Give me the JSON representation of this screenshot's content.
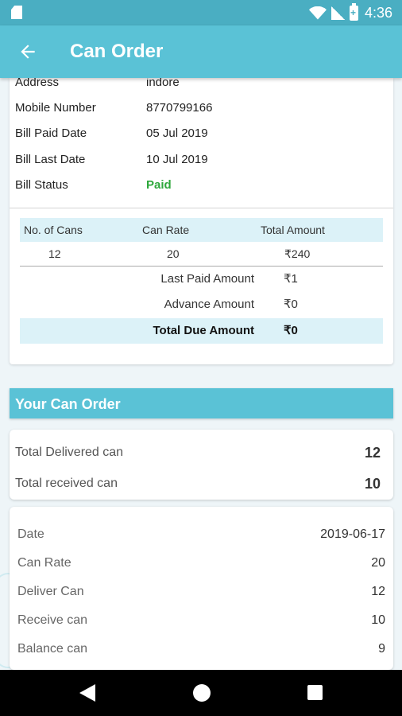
{
  "status_bar": {
    "time": "4:36",
    "battery_glyph": "+",
    "icons": [
      "sim-icon",
      "wifi-icon",
      "signal-icon",
      "battery-icon"
    ]
  },
  "toolbar": {
    "title": "Can Order",
    "back_icon": "arrow-left-icon"
  },
  "customer": {
    "address_label": "Address",
    "address_value": "indore",
    "mobile_label": "Mobile Number",
    "mobile_value": "8770799166",
    "paid_date_label": "Bill Paid Date",
    "paid_date_value": "05 Jul 2019",
    "last_date_label": "Bill Last Date",
    "last_date_value": "10 Jul 2019",
    "status_label": "Bill Status",
    "status_value": "Paid",
    "status_color": "#2ea83c"
  },
  "bill_table": {
    "headers": [
      "No. of Cans",
      "Can Rate",
      "Total Amount"
    ],
    "row": [
      "12",
      "20",
      "₹240"
    ],
    "last_paid_label": "Last Paid Amount",
    "last_paid_value": "₹1",
    "advance_label": "Advance Amount",
    "advance_value": "₹0",
    "total_due_label": "Total Due Amount",
    "total_due_value": "₹0"
  },
  "section": {
    "title": "Your Can Order"
  },
  "summary": {
    "delivered_label": "Total Delivered can",
    "delivered_value": "12",
    "received_label": "Total received can",
    "received_value": "10"
  },
  "order": {
    "date_label": "Date",
    "date_value": "2019-06-17",
    "rate_label": "Can Rate",
    "rate_value": "20",
    "deliver_label": "Deliver Can",
    "deliver_value": "12",
    "receive_label": "Receive can",
    "receive_value": "10",
    "balance_label": "Balance can",
    "balance_value": "9"
  },
  "colors": {
    "primary": "#5ac2d6",
    "status_bar": "#4aaec2",
    "table_header": "#dcf2f8"
  },
  "nav": {
    "icons": [
      "back-triangle-icon",
      "home-circle-icon",
      "recents-square-icon"
    ]
  }
}
